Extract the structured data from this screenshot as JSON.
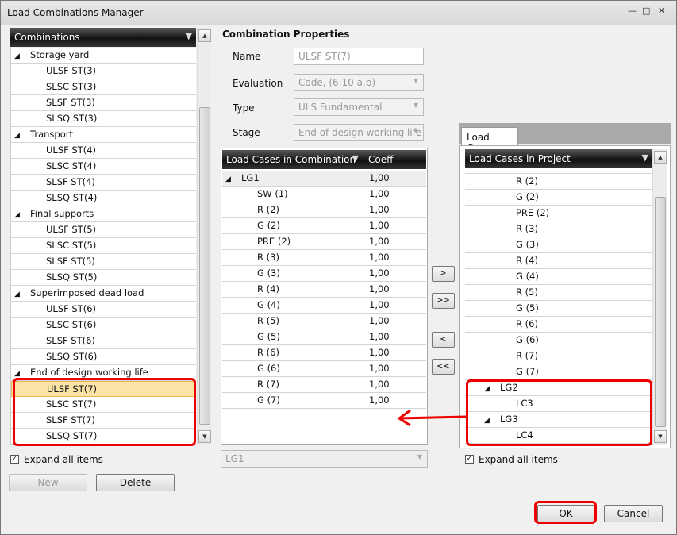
{
  "window": {
    "title": "Load Combinations Manager",
    "min": "—",
    "max": "□",
    "close": "✕"
  },
  "combinations": {
    "header": "Combinations",
    "groups": [
      {
        "label": "Storage yard",
        "items": [
          "ULSF ST(3)",
          "SLSC ST(3)",
          "SLSF ST(3)",
          "SLSQ ST(3)"
        ]
      },
      {
        "label": "Transport",
        "items": [
          "ULSF ST(4)",
          "SLSC ST(4)",
          "SLSF ST(4)",
          "SLSQ ST(4)"
        ]
      },
      {
        "label": "Final supports",
        "items": [
          "ULSF ST(5)",
          "SLSC ST(5)",
          "SLSF ST(5)",
          "SLSQ ST(5)"
        ]
      },
      {
        "label": "Superimposed dead load",
        "items": [
          "ULSF ST(6)",
          "SLSC ST(6)",
          "SLSF ST(6)",
          "SLSQ ST(6)"
        ]
      },
      {
        "label": "End of design working life",
        "items": [
          "ULSF ST(7)",
          "SLSC ST(7)",
          "SLSF ST(7)",
          "SLSQ ST(7)"
        ]
      }
    ],
    "selected": "ULSF ST(7)",
    "expand_all": "Expand all items",
    "new": "New",
    "delete": "Delete"
  },
  "properties": {
    "title": "Combination Properties",
    "name_label": "Name",
    "name": "ULSF ST(7)",
    "evaluation_label": "Evaluation",
    "evaluation": "Code, (6.10 a,b)",
    "type_label": "Type",
    "type": "ULS Fundamental",
    "stage_label": "Stage",
    "stage": "End of design working life"
  },
  "combination_cases": {
    "header": "Load Cases in Combination",
    "coeff_header": "Coeff",
    "group": "LG1",
    "group_coeff": "1,00",
    "rows": [
      [
        "SW (1)",
        "1,00"
      ],
      [
        "R (2)",
        "1,00"
      ],
      [
        "G (2)",
        "1,00"
      ],
      [
        "PRE (2)",
        "1,00"
      ],
      [
        "R (3)",
        "1,00"
      ],
      [
        "G (3)",
        "1,00"
      ],
      [
        "R (4)",
        "1,00"
      ],
      [
        "G (4)",
        "1,00"
      ],
      [
        "R (5)",
        "1,00"
      ],
      [
        "G (5)",
        "1,00"
      ],
      [
        "R (6)",
        "1,00"
      ],
      [
        "G (6)",
        "1,00"
      ],
      [
        "R (7)",
        "1,00"
      ],
      [
        "G (7)",
        "1,00"
      ]
    ],
    "group_select": "LG1"
  },
  "transfer": {
    "add": ">",
    "add_all": ">>",
    "remove": "<",
    "remove_all": "<<"
  },
  "project_cases": {
    "tab": "Load Cases",
    "header": "Load Cases in Project",
    "rows": [
      "R (2)",
      "G (2)",
      "PRE (2)",
      "R (3)",
      "G (3)",
      "R (4)",
      "G (4)",
      "R (5)",
      "G (5)",
      "R (6)",
      "G (6)",
      "R (7)",
      "G (7)"
    ],
    "groups": [
      {
        "label": "LG2",
        "items": [
          "LC3"
        ]
      },
      {
        "label": "LG3",
        "items": [
          "LC4"
        ]
      }
    ],
    "expand_all": "Expand all items"
  },
  "footer": {
    "ok": "OK",
    "cancel": "Cancel"
  },
  "colors": {
    "annotation": "#e00000",
    "selected_row": "#fbe3a6"
  }
}
